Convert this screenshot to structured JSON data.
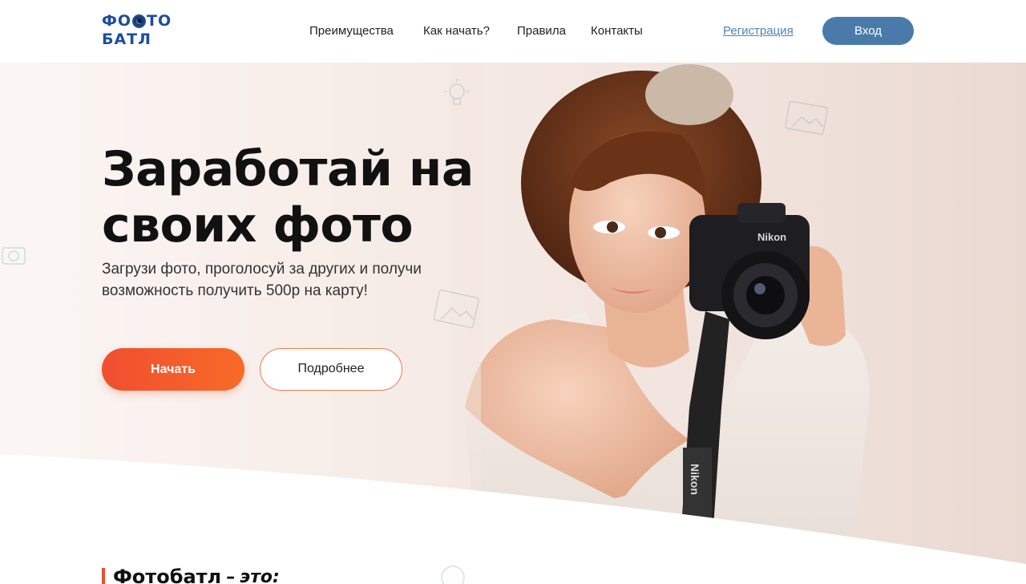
{
  "header": {
    "logo": {
      "line1_a": "ФО",
      "line1_b": "ТО",
      "line2": "БАТЛ"
    },
    "nav": [
      {
        "label": "Преимущества"
      },
      {
        "label": "Как начать?"
      },
      {
        "label": "Правила"
      },
      {
        "label": "Контакты"
      }
    ],
    "register_label": "Регистрация",
    "login_label": "Вход"
  },
  "hero": {
    "title_line1": "Заработай на",
    "title_line2": "своих фото",
    "subtitle": "Загрузи фото, проголосуй за других и получи возможность получить 500р на карту!",
    "start_label": "Начать",
    "more_label": "Подробнее",
    "camera_brand": "Nikon",
    "strap_brand": "Nikon"
  },
  "section": {
    "title": "Фотобатл",
    "dash": "–",
    "suffix": "это:"
  },
  "colors": {
    "brand_blue": "#1c4e9b",
    "login_button": "#4a7aaa",
    "accent_orange": "#f04e30",
    "link_blue": "#4a86b8"
  },
  "icons": [
    "lens-icon",
    "lightbulb-icon",
    "image-frame-icon",
    "camera-doodle-icon"
  ]
}
